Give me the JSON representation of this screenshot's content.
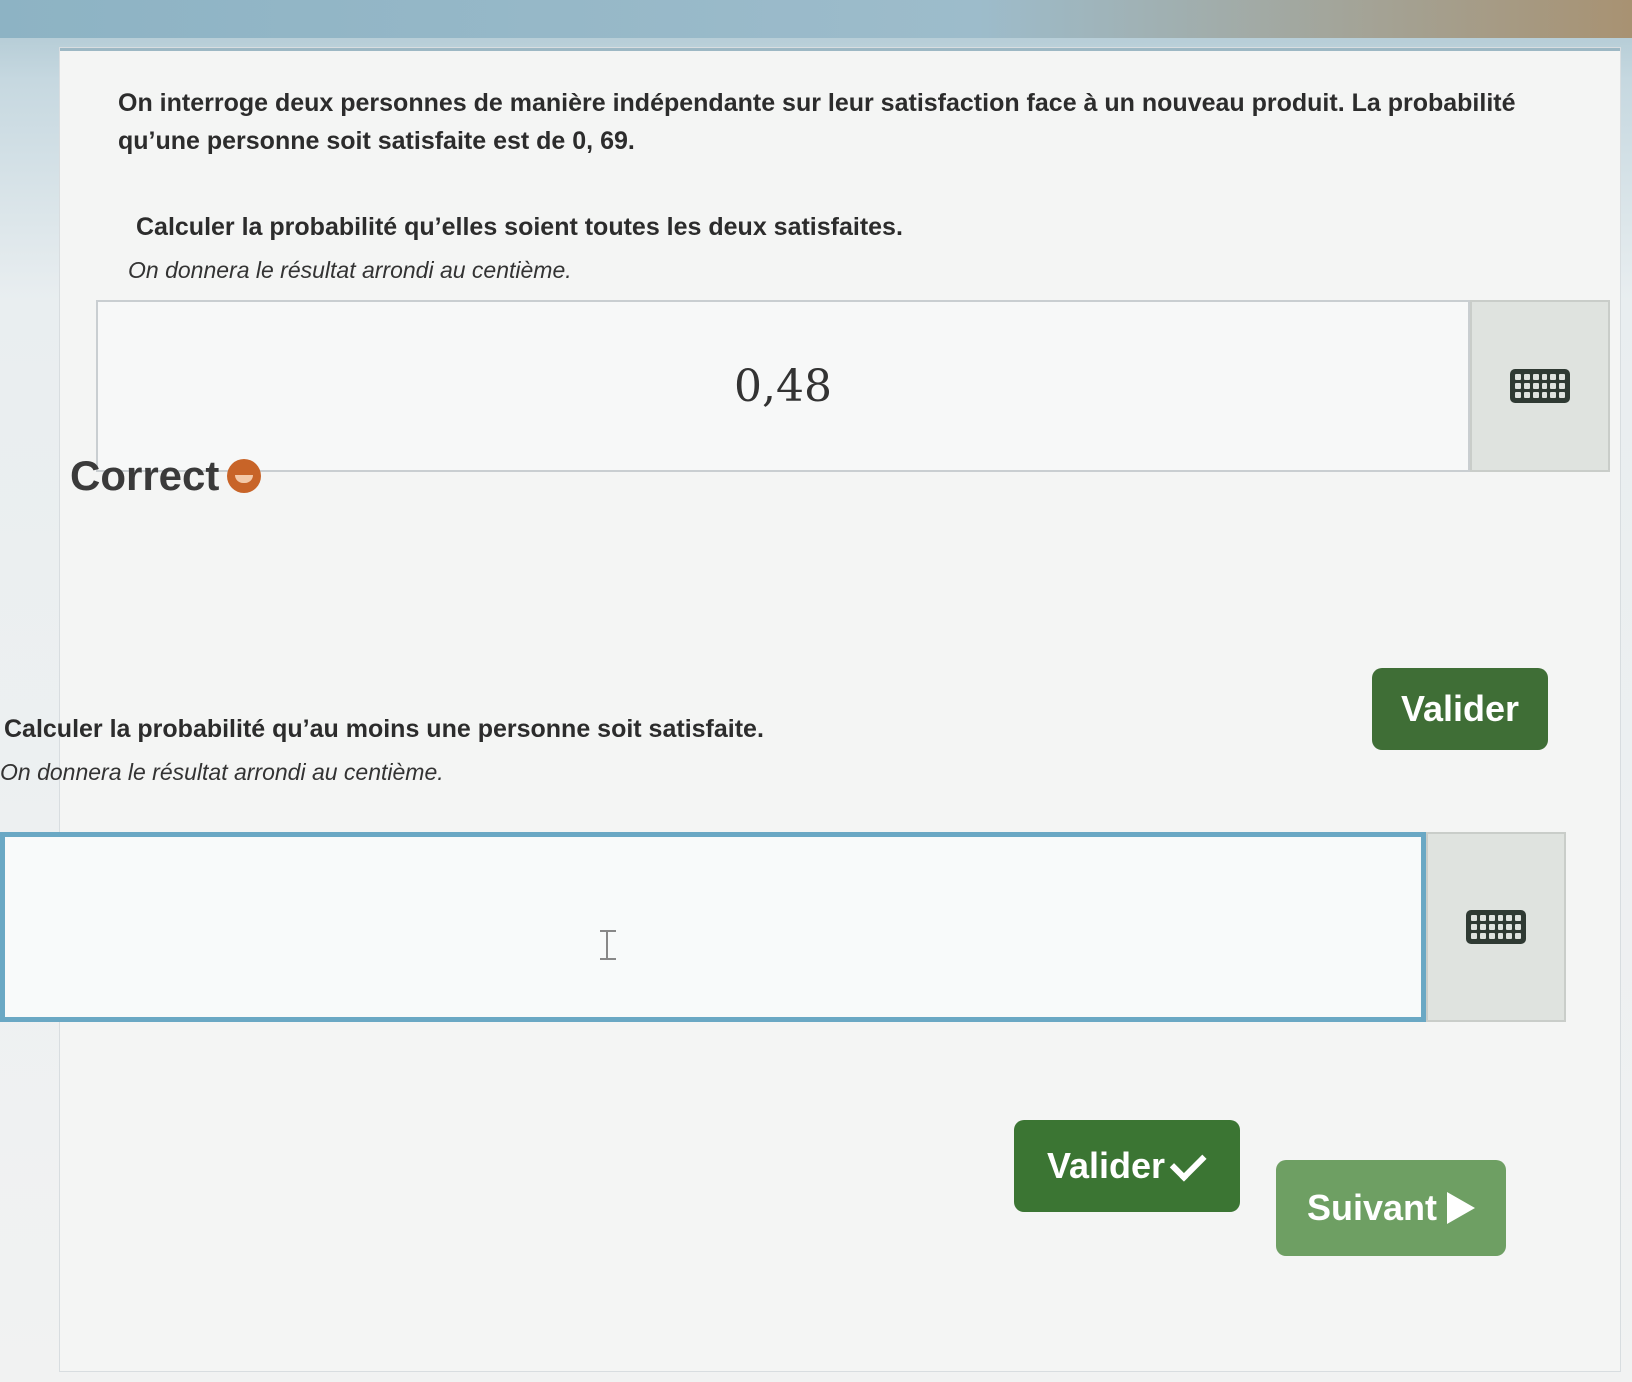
{
  "exercise": {
    "intro": "On interroge deux personnes de manière indépendante sur leur satisfaction face à un nouveau produit. La probabilité qu’une personne soit satisfaite est de 0, 69."
  },
  "question1": {
    "prompt": "Calculer la probabilité qu’elles soient toutes les deux satisfaites.",
    "hint": "On donnera le résultat arrondi au centième.",
    "answer_value": "0,48",
    "keyboard_icon": "keyboard-icon",
    "feedback_label": "Correct",
    "feedback_icon": "smiley-icon",
    "validate_label": "Valider"
  },
  "question2": {
    "prompt": "Calculer la probabilité qu’au moins une personne soit satisfaite.",
    "hint": "On donnera le résultat arrondi au centième.",
    "answer_value": "",
    "keyboard_icon": "keyboard-icon",
    "validate_label": "Valider",
    "validate_icon": "check-icon",
    "next_label": "Suivant",
    "next_icon": "play-arrow-icon"
  },
  "colors": {
    "validate_button": "#3b7533",
    "next_button": "#6e9f63",
    "active_field_border": "#6aa8c4",
    "feedback_smiley": "#c86428"
  }
}
